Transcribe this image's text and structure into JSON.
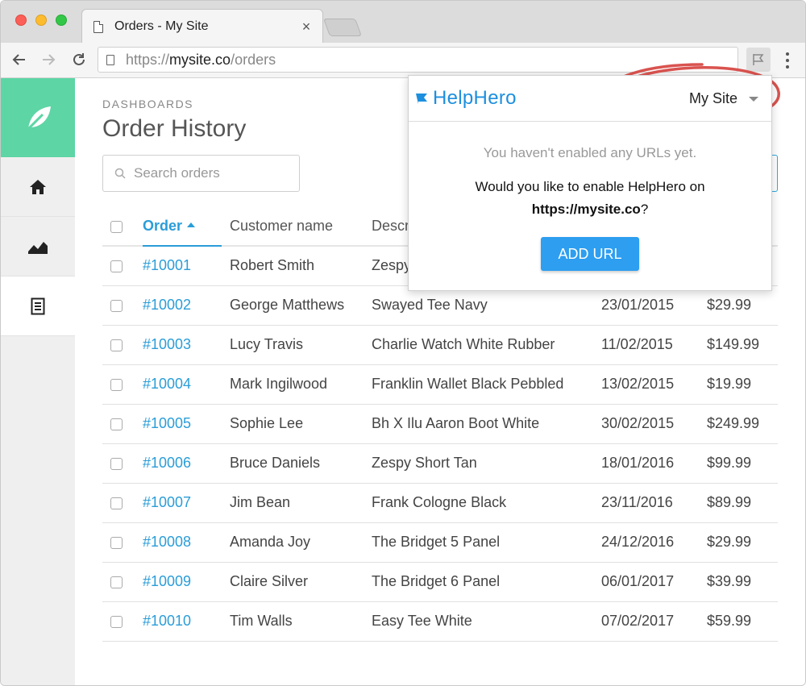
{
  "browser": {
    "tab_title": "Orders - My Site",
    "tab_close": "×",
    "url_scheme": "https://",
    "url_host": "mysite.co",
    "url_path": "/orders"
  },
  "app": {
    "breadcrumb": "DASHBOARDS",
    "title": "Order History",
    "search_placeholder": "Search orders",
    "brand_color": "#5dd5a5",
    "link_color": "#2a9dd8"
  },
  "sidebar": {
    "items": [
      {
        "icon": "home-icon"
      },
      {
        "icon": "chart-icon"
      },
      {
        "icon": "document-icon",
        "active": true
      }
    ]
  },
  "table": {
    "headers": {
      "order": "Order",
      "customer": "Customer name",
      "description": "Description"
    },
    "rows": [
      {
        "order": "#10001",
        "customer": "Robert Smith",
        "description": "Zespy",
        "date": "",
        "total": ""
      },
      {
        "order": "#10002",
        "customer": "George Matthews",
        "description": "Swayed Tee Navy",
        "date": "23/01/2015",
        "total": "$29.99"
      },
      {
        "order": "#10003",
        "customer": "Lucy Travis",
        "description": "Charlie Watch White Rubber",
        "date": "11/02/2015",
        "total": "$149.99"
      },
      {
        "order": "#10004",
        "customer": "Mark Ingilwood",
        "description": "Franklin Wallet Black Pebbled",
        "date": "13/02/2015",
        "total": "$19.99"
      },
      {
        "order": "#10005",
        "customer": "Sophie Lee",
        "description": "Bh X Ilu Aaron Boot White",
        "date": "30/02/2015",
        "total": "$249.99"
      },
      {
        "order": "#10006",
        "customer": "Bruce Daniels",
        "description": "Zespy Short Tan",
        "date": "18/01/2016",
        "total": "$99.99"
      },
      {
        "order": "#10007",
        "customer": "Jim Bean",
        "description": "Frank Cologne Black",
        "date": "23/11/2016",
        "total": "$89.99"
      },
      {
        "order": "#10008",
        "customer": "Amanda Joy",
        "description": "The Bridget 5 Panel",
        "date": "24/12/2016",
        "total": "$29.99"
      },
      {
        "order": "#10009",
        "customer": "Claire Silver",
        "description": "The Bridget 6 Panel",
        "date": "06/01/2017",
        "total": "$39.99"
      },
      {
        "order": "#10010",
        "customer": "Tim Walls",
        "description": "Easy Tee White",
        "date": "07/02/2017",
        "total": "$59.99"
      }
    ]
  },
  "helphero": {
    "brand": "HelpHero",
    "site_selector": "My Site",
    "no_urls_text": "You haven't enabled any URLs yet.",
    "question_prefix": "Would you like to enable HelpHero on",
    "question_url": "https://mysite.co",
    "question_suffix": "?",
    "button": "ADD URL",
    "brand_color": "#1d8fde",
    "button_color": "#2d9ef0",
    "annotation_color": "#d9534f"
  }
}
